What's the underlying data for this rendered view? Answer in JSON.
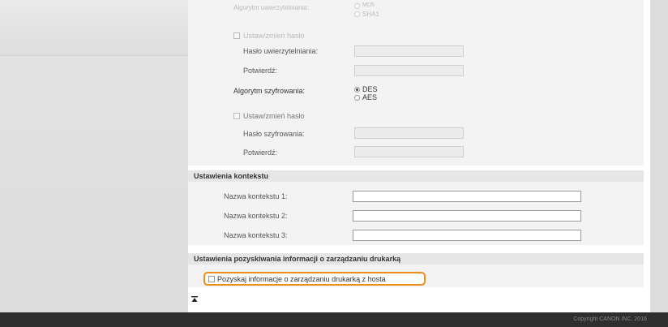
{
  "snmpv3": {
    "auth_algorithm_label": "Algorytm uwierzytelniania:",
    "auth_algorithm_option_md5": "MD5",
    "auth_algorithm_option_sha1": "SHA1",
    "set_auth_password_label": "Ustaw/zmień hasło",
    "auth_password_label": "Hasło uwierzytelniania:",
    "auth_confirm_label": "Potwierdź:",
    "encryption_algorithm_label": "Algorytm szyfrowania:",
    "encryption_option_des": "DES",
    "encryption_option_aes": "AES",
    "encryption_selected": "DES",
    "set_enc_password_label": "Ustaw/zmień hasło",
    "enc_password_label": "Hasło szyfrowania:",
    "enc_confirm_label": "Potwierdź:"
  },
  "context_settings": {
    "title": "Ustawienia kontekstu",
    "fields": [
      {
        "label": "Nazwa kontekstu 1:",
        "value": ""
      },
      {
        "label": "Nazwa kontekstu 2:",
        "value": ""
      },
      {
        "label": "Nazwa kontekstu 3:",
        "value": ""
      }
    ]
  },
  "printer_mgmt": {
    "title": "Ustawienia pozyskiwania informacji o zarządzaniu drukarką",
    "checkbox_label": "Pozyskaj informacje o zarządzaniu drukarką z hosta"
  },
  "footer": {
    "copyright": "Copyright CANON INC. 2016"
  },
  "icons": {
    "back_to_top": "back-to-top-icon"
  }
}
